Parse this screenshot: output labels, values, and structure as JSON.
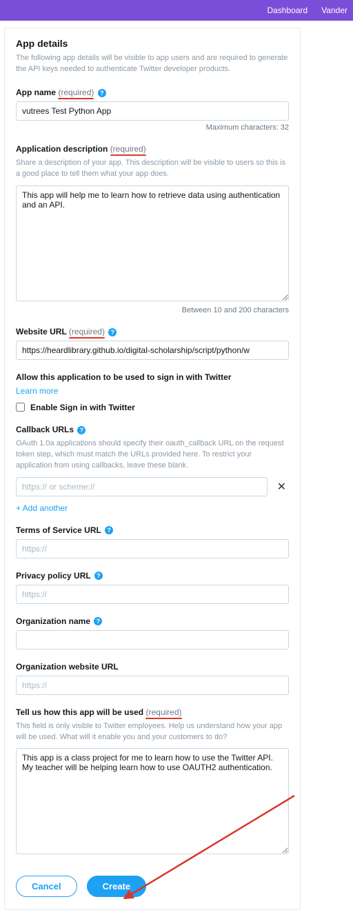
{
  "nav": {
    "dashboard": "Dashboard",
    "user": "Vander"
  },
  "page": {
    "title": "App details",
    "subtitle": "The following app details will be visible to app users and are required to generate the API keys needed to authenticate Twitter developer products."
  },
  "appName": {
    "label": "App name",
    "required": "(required)",
    "value": "vutrees Test Python App",
    "counter": "Maximum characters: 32"
  },
  "appDesc": {
    "label": "Application description",
    "required": "(required)",
    "help": "Share a description of your app. This description will be visible to users so this is a good place to tell them what your app does.",
    "value": "This app will help me to learn how to retrieve data using authentication and an API.",
    "counter": "Between 10 and 200 characters"
  },
  "website": {
    "label": "Website URL",
    "required": "(required)",
    "value": "https://heardlibrary.github.io/digital-scholarship/script/python/w"
  },
  "signin": {
    "label": "Allow this application to be used to sign in with Twitter",
    "learn": "Learn more",
    "checkboxLabel": "Enable Sign in with Twitter"
  },
  "callback": {
    "label": "Callback URLs",
    "help": "OAuth 1.0a applications should specify their oauth_callback URL on the request token step, which must match the URLs provided here. To restrict your application from using callbacks, leave these blank.",
    "placeholder": "https:// or scheme://",
    "addAnother": "+  Add another"
  },
  "tos": {
    "label": "Terms of Service URL",
    "placeholder": "https://"
  },
  "privacy": {
    "label": "Privacy policy URL",
    "placeholder": "https://"
  },
  "orgName": {
    "label": "Organization name"
  },
  "orgUrl": {
    "label": "Organization website URL",
    "placeholder": "https://"
  },
  "usage": {
    "label": "Tell us how this app will be used",
    "required": "(required)",
    "help": "This field is only visible to Twitter employees. Help us understand how your app will be used. What will it enable you and your customers to do?",
    "value": "This app is a class project for me to learn how to use the Twitter API.  My teacher will be helping learn how to use OAUTH2 authentication."
  },
  "buttons": {
    "cancel": "Cancel",
    "create": "Create"
  }
}
